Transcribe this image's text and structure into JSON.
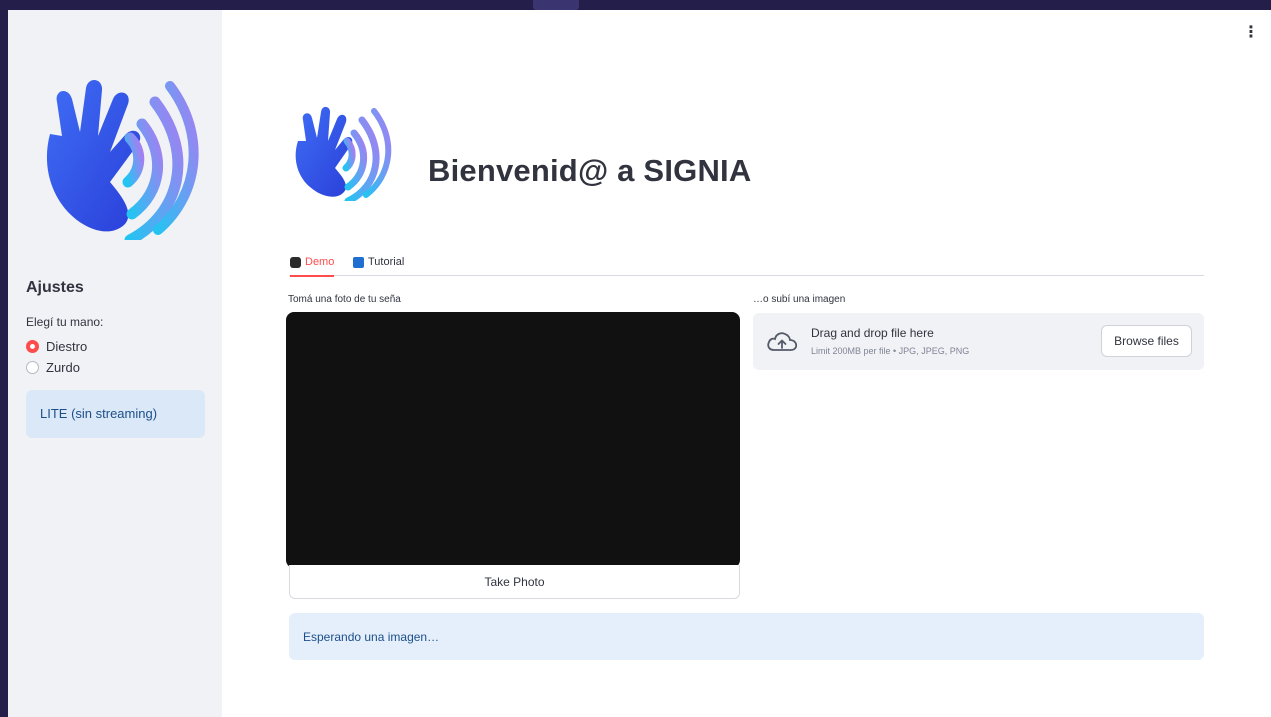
{
  "sidebar": {
    "logo_icon": "signia-hand-wave-icon",
    "settings_title": "Ajustes",
    "hand_label": "Elegí tu mano:",
    "hand_options": [
      {
        "label": "Diestro",
        "selected": true
      },
      {
        "label": "Zurdo",
        "selected": false
      }
    ],
    "mode_info": "LITE (sin streaming)"
  },
  "header": {
    "menu_icon": "vertical-ellipsis-icon",
    "menu_glyph": "⋮",
    "logo_icon": "signia-hand-wave-icon",
    "title": "Bienvenid@ a SIGNIA"
  },
  "tabs": [
    {
      "label": "Demo",
      "icon": "camera-icon",
      "active": true
    },
    {
      "label": "Tutorial",
      "icon": "book-icon",
      "active": false
    }
  ],
  "camera": {
    "label": "Tomá una foto de tu seña",
    "button_label": "Take Photo"
  },
  "upload": {
    "label": "…o subí una imagen",
    "dropzone_title": "Drag and drop file here",
    "dropzone_limit": "Limit 200MB per file • JPG, JPEG, PNG",
    "browse_label": "Browse files",
    "cloud_icon": "cloud-upload-icon"
  },
  "status": {
    "message": "Esperando una imagen…"
  },
  "colors": {
    "accent": "#ff4b4b",
    "info_text": "#1c4f8a",
    "background_outer": "#231f4a",
    "sidebar_bg": "#f0f2f6"
  }
}
